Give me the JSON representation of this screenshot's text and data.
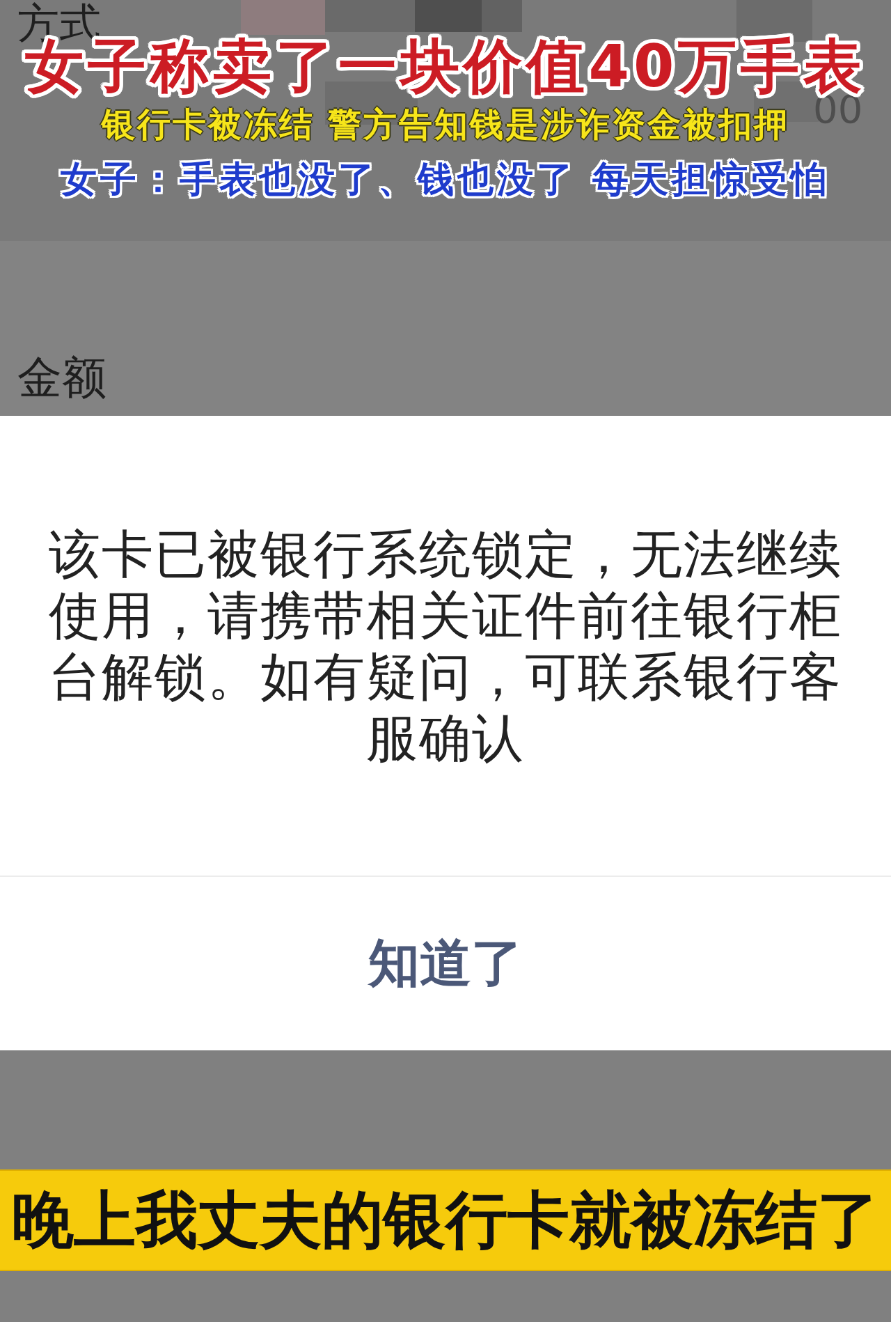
{
  "app_background": {
    "label_1": "方式",
    "label_2": "金额",
    "amount_fragment": "00"
  },
  "captions": [
    {
      "kind": "headline",
      "text": "女子称卖了一块价值40万手表"
    },
    {
      "kind": "subline",
      "text": "银行卡被冻结 警方告知钱是涉诈资金被扣押"
    },
    {
      "kind": "quote",
      "text": "女子：手表也没了、钱也没了 每天担惊受怕"
    }
  ],
  "dialog": {
    "message": "该卡已被银行系统锁定，无法继续使用，请携带相关证件前往银行柜台解锁。如有疑问，可联系银行客服确认",
    "button": "知道了"
  },
  "subtitle": "晚上我丈夫的银行卡就被冻结了"
}
